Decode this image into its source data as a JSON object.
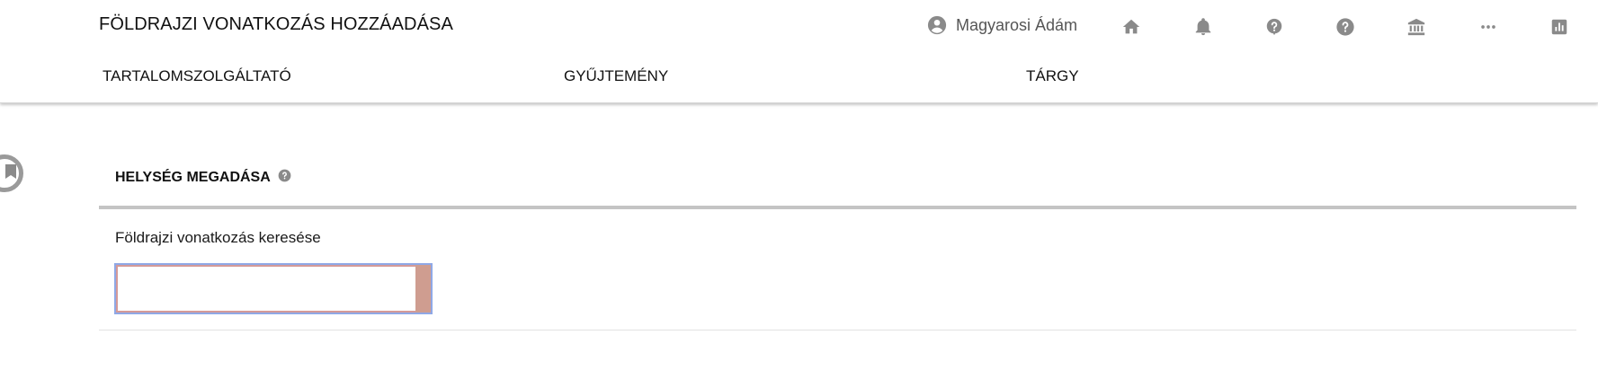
{
  "header": {
    "title": "FÖLDRAJZI VONATKOZÁS HOZZÁADÁSA",
    "user_name": "Magyarosi Ádám",
    "icons": [
      "account-circle-icon",
      "home-icon",
      "bell-icon",
      "help-bubble-icon",
      "help-circle-icon",
      "institution-icon",
      "more-icon",
      "report-icon"
    ]
  },
  "steps": [
    {
      "label": "TARTALOMSZOLGÁLTATÓ"
    },
    {
      "label": "GYŰJTEMÉNY"
    },
    {
      "label": "TÁRGY"
    }
  ],
  "section": {
    "title": "HELYSÉG MEGADÁSA"
  },
  "search": {
    "label": "Földrajzi vonatkozás keresése",
    "value": "",
    "placeholder": ""
  },
  "colors": {
    "icon_gray": "#8a8a8a",
    "input_focus_border": "#8fa8e6",
    "input_error_border": "#d59a98",
    "input_side": "#cf9d90",
    "section_rule": "#c4c4c4"
  }
}
